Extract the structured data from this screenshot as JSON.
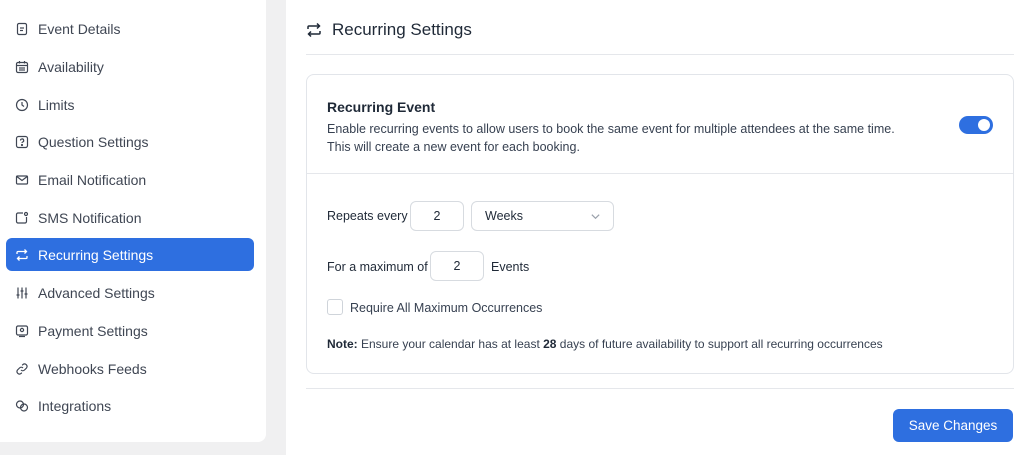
{
  "sidebar": {
    "items": [
      {
        "label": "Event Details",
        "icon": "document-icon"
      },
      {
        "label": "Availability",
        "icon": "calendar-icon"
      },
      {
        "label": "Limits",
        "icon": "clock-icon"
      },
      {
        "label": "Question Settings",
        "icon": "question-icon"
      },
      {
        "label": "Email Notification",
        "icon": "envelope-icon"
      },
      {
        "label": "SMS Notification",
        "icon": "sms-icon"
      },
      {
        "label": "Recurring Settings",
        "icon": "repeat-icon",
        "active": true
      },
      {
        "label": "Advanced Settings",
        "icon": "sliders-icon"
      },
      {
        "label": "Payment Settings",
        "icon": "payment-icon"
      },
      {
        "label": "Webhooks Feeds",
        "icon": "link-icon"
      },
      {
        "label": "Integrations",
        "icon": "integrations-icon"
      }
    ]
  },
  "header": {
    "title": "Recurring Settings",
    "icon": "repeat-icon"
  },
  "recurring": {
    "title": "Recurring Event",
    "description": "Enable recurring events to allow users to book the same event for multiple attendees at the same time. This will create a new event for each booking.",
    "enabled": true,
    "repeats_label": "Repeats every",
    "repeats_value": "2",
    "unit_value": "Weeks",
    "max_label": "For a maximum of",
    "max_value": "2",
    "max_suffix": "Events",
    "require_label": "Require All Maximum Occurrences",
    "require_checked": false,
    "note_prefix": "Note:",
    "note_text_1": " Ensure your calendar has at least ",
    "note_days": "28",
    "note_text_2": " days of future availability to support all recurring occurrences"
  },
  "footer": {
    "save_label": "Save Changes"
  },
  "colors": {
    "accent": "#2e6fe0",
    "background": "#f0f0f1"
  }
}
